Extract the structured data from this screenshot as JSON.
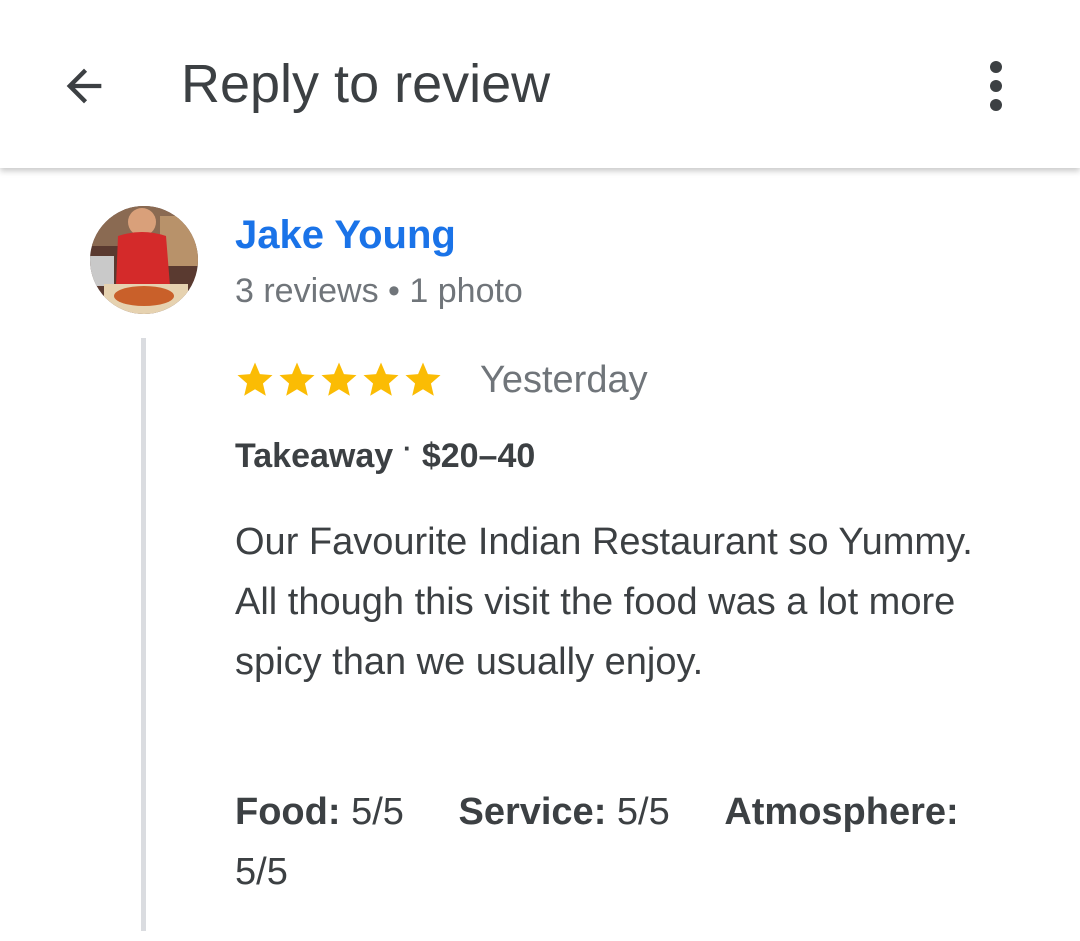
{
  "header": {
    "title": "Reply to review",
    "back_icon": "arrow-back-icon",
    "menu_icon": "more-vert-icon"
  },
  "review": {
    "reviewer_name": "Jake Young",
    "reviewer_meta": "3 reviews • 1 photo",
    "rating": 5,
    "rating_max": 5,
    "date": "Yesterday",
    "service_type": "Takeaway",
    "price_range": "$20–40",
    "text_paragraphs": [
      "Our Favourite Indian Restaurant so Yummy.",
      "All though this visit the food was a lot more spicy than we usually enjoy."
    ],
    "sub_ratings": [
      {
        "label": "Food:",
        "value": "5/5"
      },
      {
        "label": "Service:",
        "value": "5/5"
      },
      {
        "label": "Atmosphere:",
        "value": "5/5"
      }
    ]
  },
  "colors": {
    "name_link": "#1a73e8",
    "star": "#fbbc04",
    "text_primary": "#3c4043",
    "text_secondary": "#70757a",
    "thread_line": "#dadce0"
  }
}
